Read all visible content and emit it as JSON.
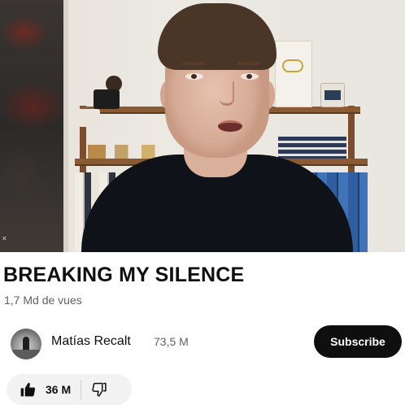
{
  "video": {
    "title": "BREAKING MY SILENCE",
    "views": "1,7 Md de vues"
  },
  "channel": {
    "name": "Matías Recalt",
    "subscribers": "73,5 M",
    "subscribe_label": "Subscribe"
  },
  "actions": {
    "like_count": "36 M",
    "like_icon": "thumbs-up-icon",
    "dislike_icon": "thumbs-down-icon"
  },
  "colors": {
    "subscribe_bg": "#0f0f0f",
    "subscribe_text": "#ffffff",
    "action_bar_bg": "#f2f2f2",
    "secondary_text": "#606060"
  }
}
